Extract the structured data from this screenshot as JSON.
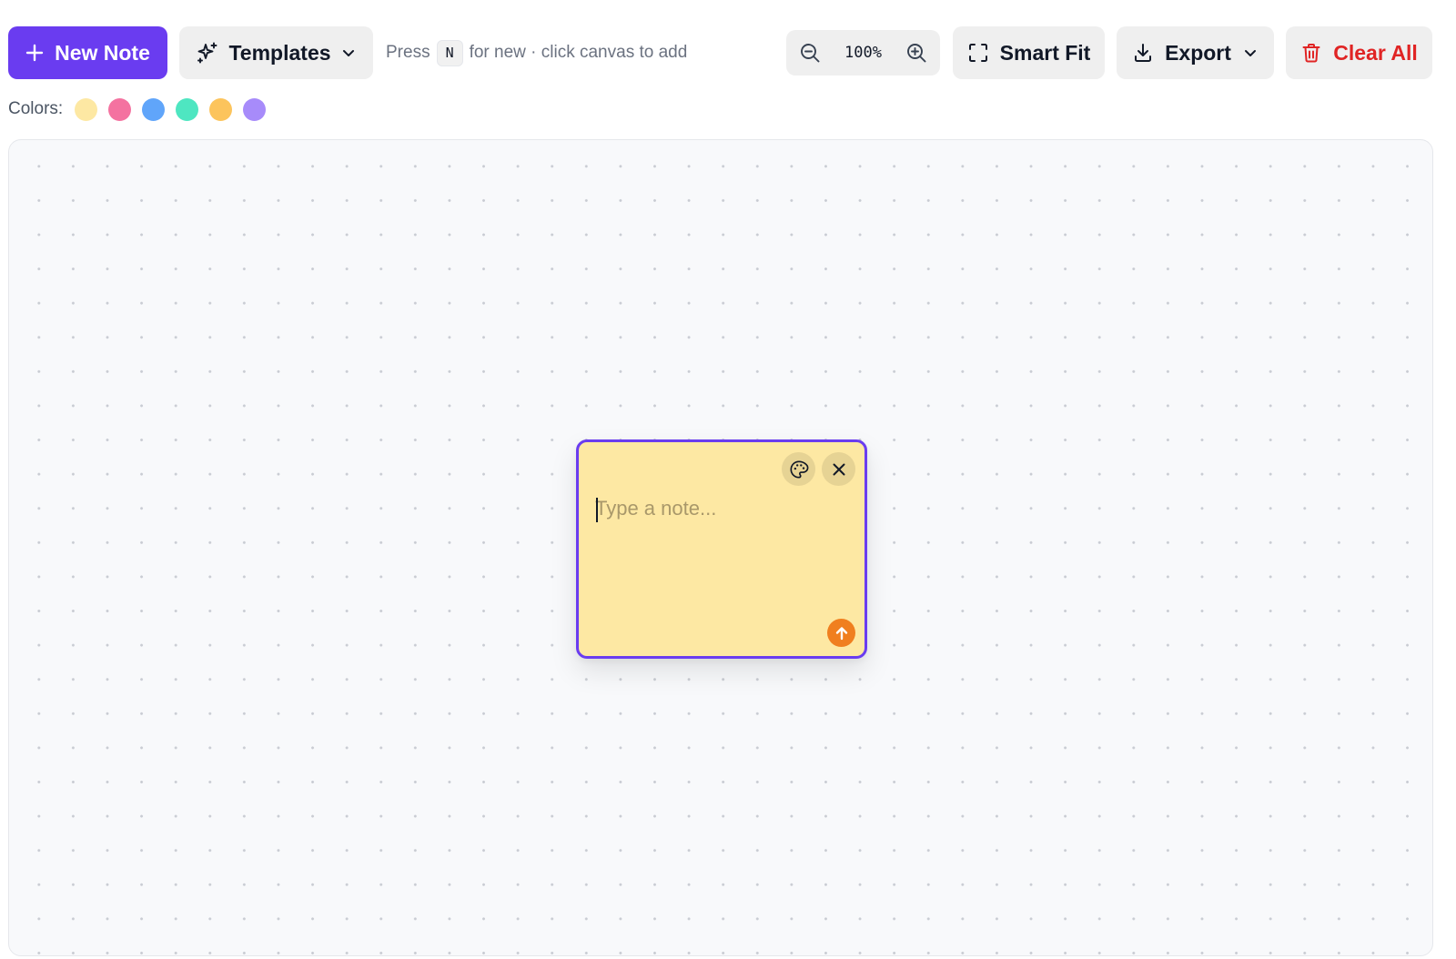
{
  "toolbar": {
    "new_note_label": "New Note",
    "templates_label": "Templates",
    "hint": {
      "before": "Press",
      "key": "N",
      "after": "for new · click canvas to add"
    },
    "zoom_level": "100%",
    "smart_fit_label": "Smart Fit",
    "export_label": "Export",
    "clear_all_label": "Clear All"
  },
  "colors": {
    "label": "Colors:",
    "swatches": [
      "#fde8a3",
      "#f472a0",
      "#60a5fa",
      "#4ee6c1",
      "#fcc45c",
      "#a78bfa"
    ]
  },
  "theme": {
    "accent": "#6a3cf0",
    "danger": "#e02424",
    "note_action": "#f07f1f"
  },
  "note": {
    "placeholder": "Type a note...",
    "value": "",
    "color": "#fde8a3"
  }
}
